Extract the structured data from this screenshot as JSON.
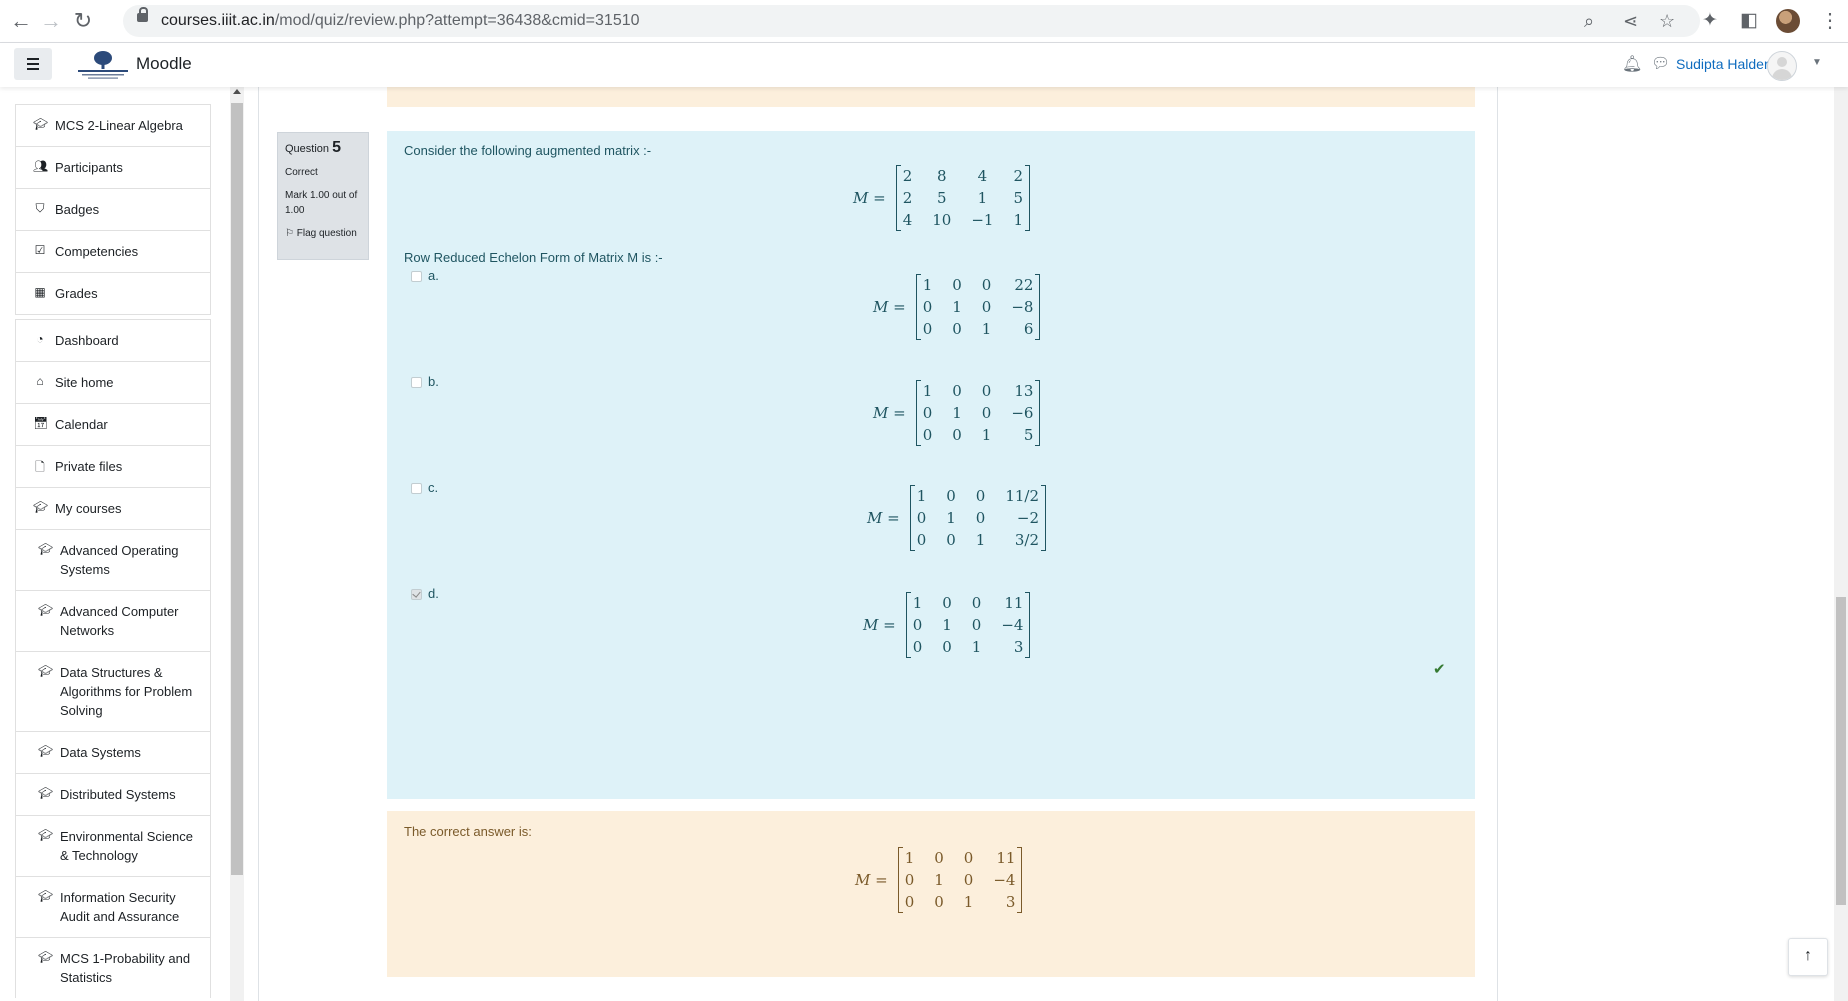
{
  "browser": {
    "url_host": "courses.iiit.ac.in",
    "url_path": "/mod/quiz/review.php?attempt=36438&cmid=31510",
    "icons": [
      "back-icon",
      "forward-icon",
      "reload-icon",
      "lock-icon",
      "zoom-icon",
      "share-icon",
      "star-icon",
      "extensions-icon",
      "sidepanel-icon",
      "profile-icon",
      "menu-icon"
    ]
  },
  "navbar": {
    "brand": "Moodle",
    "user_name": "Sudipta Halder"
  },
  "sidebar": {
    "items": [
      {
        "label": "MCS 2-Linear Algebra",
        "icon": "graduation-cap-icon"
      },
      {
        "label": "Participants",
        "icon": "users-icon"
      },
      {
        "label": "Badges",
        "icon": "shield-icon"
      },
      {
        "label": "Competencies",
        "icon": "check-square-icon"
      },
      {
        "label": "Grades",
        "icon": "table-icon"
      }
    ],
    "nav_items": [
      {
        "label": "Dashboard",
        "icon": "tachometer-icon"
      },
      {
        "label": "Site home",
        "icon": "home-icon"
      },
      {
        "label": "Calendar",
        "icon": "calendar-icon"
      },
      {
        "label": "Private files",
        "icon": "file-icon"
      },
      {
        "label": "My courses",
        "icon": "graduation-cap-icon"
      }
    ],
    "courses": [
      "Advanced Operating Systems",
      "Advanced Computer Networks",
      "Data Structures & Algorithms for Problem Solving",
      "Data Systems",
      "Distributed Systems",
      "Environmental Science & Technology",
      "Information Security Audit and Assurance",
      "MCS 1-Probability and Statistics"
    ]
  },
  "question": {
    "label": "Question",
    "number": "5",
    "state": "Correct",
    "mark": "Mark 1.00 out of 1.00",
    "flag": "Flag question",
    "text": "Consider the following augmented matrix :-",
    "matrix_label": "M =",
    "matrix": [
      [
        "2",
        "8",
        "4",
        "2"
      ],
      [
        "2",
        "5",
        "1",
        "5"
      ],
      [
        "4",
        "10",
        "−1",
        "1"
      ]
    ],
    "prompt": "Row Reduced Echelon Form of Matrix M is :-",
    "options": [
      {
        "letter": "a.",
        "checked": false,
        "matrix": [
          [
            "1",
            "0",
            "0",
            "22"
          ],
          [
            "0",
            "1",
            "0",
            "−8"
          ],
          [
            "0",
            "0",
            "1",
            "6"
          ]
        ]
      },
      {
        "letter": "b.",
        "checked": false,
        "matrix": [
          [
            "1",
            "0",
            "0",
            "13"
          ],
          [
            "0",
            "1",
            "0",
            "−6"
          ],
          [
            "0",
            "0",
            "1",
            "5"
          ]
        ]
      },
      {
        "letter": "c.",
        "checked": false,
        "matrix": [
          [
            "1",
            "0",
            "0",
            "11/2"
          ],
          [
            "0",
            "1",
            "0",
            "−2"
          ],
          [
            "0",
            "0",
            "1",
            "3/2"
          ]
        ]
      },
      {
        "letter": "d.",
        "checked": true,
        "matrix": [
          [
            "1",
            "0",
            "0",
            "11"
          ],
          [
            "0",
            "1",
            "0",
            "−4"
          ],
          [
            "0",
            "0",
            "1",
            "3"
          ]
        ]
      }
    ]
  },
  "feedback": {
    "text": "The correct answer is:",
    "matrix": [
      [
        "1",
        "0",
        "0",
        "11"
      ],
      [
        "0",
        "1",
        "0",
        "−4"
      ],
      [
        "0",
        "0",
        "1",
        "3"
      ]
    ]
  },
  "colors": {
    "question_bg": "#def2f8",
    "feedback_bg": "#fcefdc",
    "correct_tick": "#357a32",
    "link": "#0f6cbf"
  }
}
